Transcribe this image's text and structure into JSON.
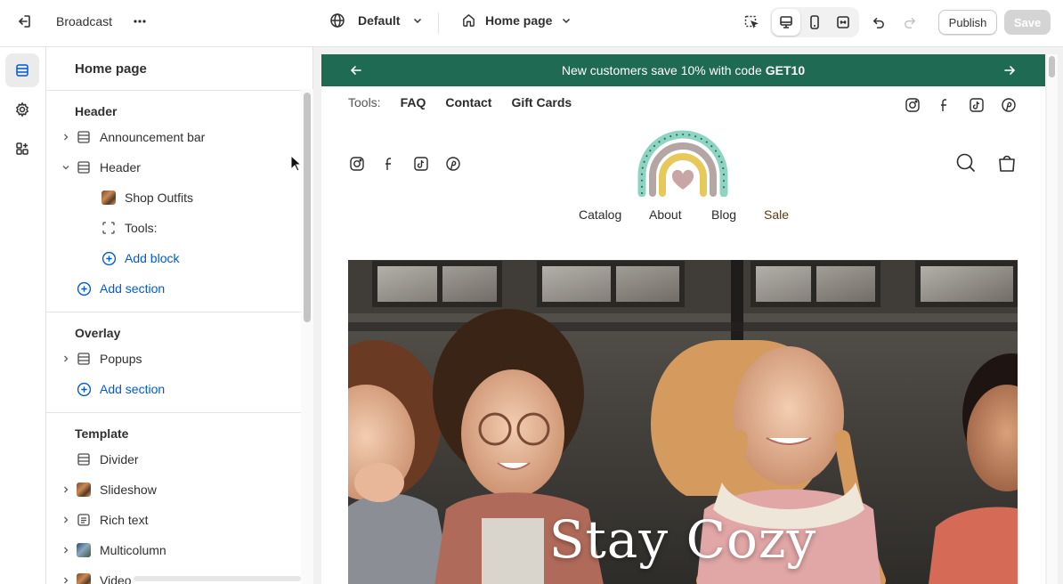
{
  "topbar": {
    "store_name": "Broadcast",
    "theme_label": "Default",
    "page_label": "Home page",
    "publish_label": "Publish",
    "save_label": "Save"
  },
  "icons": {
    "exit": "exit-icon",
    "more": "more-horizontal-icon",
    "globe": "globe-icon",
    "home": "home-icon",
    "inspector": "inspector-icon",
    "desktop": "desktop-icon",
    "mobile": "mobile-icon",
    "fullwidth": "fullwidth-icon",
    "undo": "undo-icon",
    "redo": "redo-icon"
  },
  "sidebar": {
    "title": "Home page",
    "groups": [
      {
        "title": "Header",
        "rows": [
          {
            "label": "Announcement bar",
            "kind": "section",
            "expand": "collapsed"
          },
          {
            "label": "Header",
            "kind": "section",
            "expand": "expanded"
          },
          {
            "label": "Shop Outfits",
            "kind": "block-image"
          },
          {
            "label": "Tools:",
            "kind": "block-frame"
          },
          {
            "label": "Add block",
            "kind": "add-block"
          },
          {
            "label": "Add section",
            "kind": "add-section"
          }
        ]
      },
      {
        "title": "Overlay",
        "rows": [
          {
            "label": "Popups",
            "kind": "section",
            "expand": "collapsed"
          },
          {
            "label": "Add section",
            "kind": "add-section"
          }
        ]
      },
      {
        "title": "Template",
        "rows": [
          {
            "label": "Divider",
            "kind": "section"
          },
          {
            "label": "Slideshow",
            "kind": "section-image",
            "expand": "collapsed"
          },
          {
            "label": "Rich text",
            "kind": "section-text",
            "expand": "collapsed"
          },
          {
            "label": "Multicolumn",
            "kind": "section-image",
            "expand": "collapsed"
          },
          {
            "label": "Video",
            "kind": "section-image",
            "expand": "collapsed"
          }
        ]
      }
    ]
  },
  "preview": {
    "announcement": {
      "text": "New customers save 10% with code",
      "code": "GET10"
    },
    "tools_label": "Tools:",
    "tool_links": [
      "FAQ",
      "Contact",
      "Gift Cards"
    ],
    "nav": [
      "Catalog",
      "About",
      "Blog",
      "Sale"
    ],
    "hero_title": "Stay Cozy",
    "social": [
      "instagram-icon",
      "facebook-icon",
      "tiktok-icon",
      "pinterest-icon"
    ]
  },
  "colors": {
    "accent_blue": "#005bd3",
    "announcement_bg": "#1e6a52",
    "sale_link": "#5a3a1a"
  }
}
